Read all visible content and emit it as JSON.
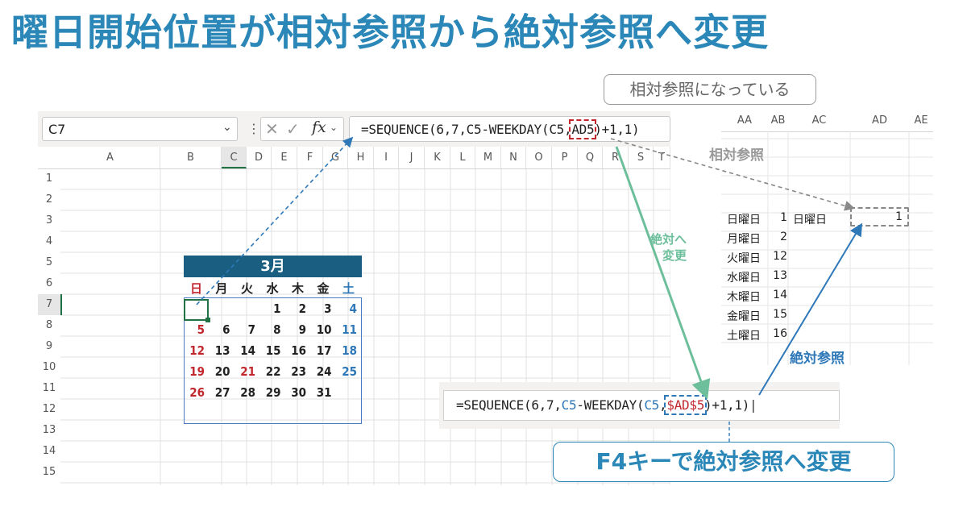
{
  "title": "曜日開始位置が相対参照から絶対参照へ変更",
  "formula_bar": {
    "name_box": "C7",
    "formula_prefix": "=SEQUENCE(6,7,C5-WEEKDAY(C5,",
    "formula_ref": "AD5",
    "formula_suffix": ")+1,1)"
  },
  "columns": [
    "A",
    "B",
    "C",
    "D",
    "E",
    "F",
    "G",
    "H",
    "I",
    "J",
    "K",
    "L",
    "M",
    "N",
    "O",
    "P",
    "Q",
    "R",
    "S",
    "T",
    "U"
  ],
  "rows": [
    "1",
    "2",
    "3",
    "4",
    "5",
    "6",
    "7",
    "8",
    "9",
    "10",
    "11",
    "12",
    "13",
    "14",
    "15"
  ],
  "calendar": {
    "month": "3月",
    "weekdays": [
      "日",
      "月",
      "火",
      "水",
      "木",
      "金",
      "土"
    ],
    "weeks": [
      [
        "",
        "",
        "",
        "1",
        "2",
        "3",
        "4"
      ],
      [
        "5",
        "6",
        "7",
        "8",
        "9",
        "10",
        "11"
      ],
      [
        "12",
        "13",
        "14",
        "15",
        "16",
        "17",
        "18"
      ],
      [
        "19",
        "20",
        "21",
        "22",
        "23",
        "24",
        "25"
      ],
      [
        "26",
        "27",
        "28",
        "29",
        "30",
        "31",
        ""
      ]
    ]
  },
  "right_sheet": {
    "columns": [
      "AA",
      "AB",
      "AC",
      "AD",
      "AE"
    ],
    "rows": [
      {
        "label": "日曜日",
        "num": "1"
      },
      {
        "label": "月曜日",
        "num": "2"
      },
      {
        "label": "火曜日",
        "num": "12"
      },
      {
        "label": "水曜日",
        "num": "13"
      },
      {
        "label": "木曜日",
        "num": "14"
      },
      {
        "label": "金曜日",
        "num": "15"
      },
      {
        "label": "土曜日",
        "num": "16"
      }
    ],
    "ac_value": "日曜日",
    "ad_value": "1"
  },
  "callouts": {
    "relative": "相対参照になっている",
    "f4": "F4キーで絶対参照へ変更"
  },
  "labels": {
    "relative_ref": "相対参照",
    "to_absolute_line1": "絶対へ",
    "to_absolute_line2": "変更",
    "absolute_ref": "絶対参照"
  },
  "formula2": {
    "prefix": "=SEQUENCE(6,7,",
    "c5a": "C5",
    "mid": "-WEEKDAY(",
    "c5b": "C5",
    "comma": ",",
    "ref": "$AD$5",
    "suffix": ")+1,1)"
  },
  "colors": {
    "title": "#2b87b7",
    "header": "#1a5f82",
    "sunday": "#c1272d",
    "saturday": "#2e78b8",
    "green_arrow": "#6dbf9c"
  }
}
